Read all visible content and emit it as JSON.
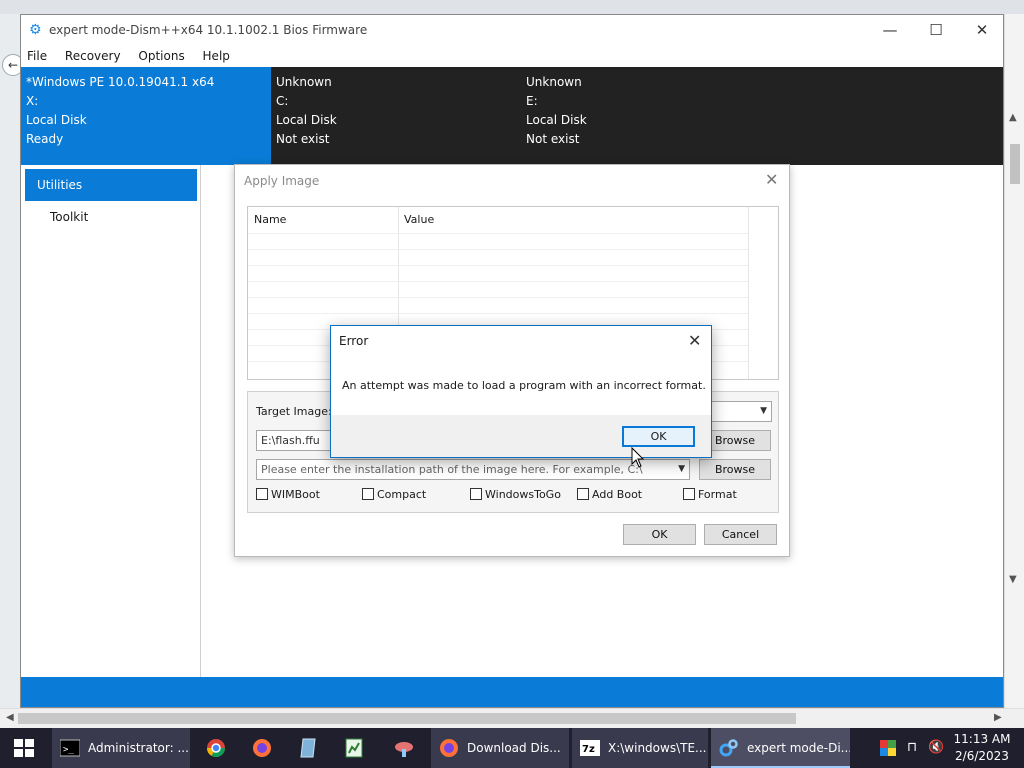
{
  "window": {
    "title": "expert mode-Dism++x64 10.1.1002.1 Bios Firmware",
    "controls": {
      "minimize": "—",
      "maximize": "☐",
      "close": "✕"
    }
  },
  "menu": [
    "File",
    "Recovery",
    "Options",
    "Help"
  ],
  "drives": [
    {
      "name": "*Windows PE 10.0.19041.1 x64",
      "letter": "X:",
      "type": "Local Disk",
      "status": "Ready"
    },
    {
      "name": "Unknown",
      "letter": "C:",
      "type": "Local Disk",
      "status": "Not exist"
    },
    {
      "name": "Unknown",
      "letter": "E:",
      "type": "Local Disk",
      "status": "Not exist"
    }
  ],
  "sidebar": {
    "items": [
      {
        "label": "Utilities"
      },
      {
        "label": "Toolkit"
      }
    ]
  },
  "apply_dialog": {
    "title": "Apply Image",
    "columns": [
      "Name",
      "Value"
    ],
    "target_label": "Target Image:",
    "source_value": "E:\\flash.ffu",
    "install_placeholder": "Please enter the installation path of the image here. For example, C:\\",
    "browse_label": "Browse",
    "options": [
      "WIMBoot",
      "Compact",
      "WindowsToGo",
      "Add Boot",
      "Format"
    ],
    "ok_label": "OK",
    "cancel_label": "Cancel"
  },
  "error_dialog": {
    "title": "Error",
    "message": "An attempt was made to load a program with an incorrect format.",
    "ok_label": "OK"
  },
  "taskbar": {
    "items": [
      {
        "label": "Administrator: ..."
      },
      {
        "label": "Download Dis..."
      },
      {
        "label": "X:\\windows\\TE..."
      },
      {
        "label": "expert mode-Di..."
      }
    ],
    "time": "11:13 AM",
    "date": "2/6/2023"
  },
  "colors": {
    "accent": "#0a7bd6",
    "drive_bar": "#222222",
    "taskbar": "#1f1f2e"
  }
}
